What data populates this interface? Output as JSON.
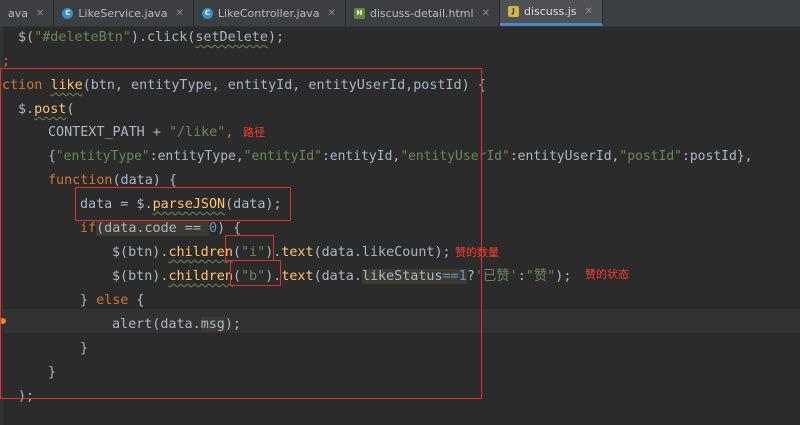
{
  "tabs": [
    {
      "label": "ava",
      "icon": "java"
    },
    {
      "label": "LikeService.java",
      "icon": "java"
    },
    {
      "label": "LikeController.java",
      "icon": "java"
    },
    {
      "label": "discuss-detail.html",
      "icon": "html"
    },
    {
      "label": "discuss.js",
      "icon": "js",
      "active": true
    }
  ],
  "code": {
    "l1": {
      "a": "$(",
      "b": "\"#deleteBtn\"",
      "c": ").click(",
      "d": "setDelete",
      "e": ");"
    },
    "l2": {
      "a": ";"
    },
    "l3": {
      "kw": "nction ",
      "fn": "like",
      "rest": "(btn, entityType, entityId, entityUserId,postId) {"
    },
    "l4": {
      "a": "$.",
      "fn": "post",
      "b": "("
    },
    "l5": {
      "a": "CONTEXT_PATH + ",
      "b": "\"/like\"",
      "c": ","
    },
    "l6": {
      "a": "{",
      "k1": "\"entityType\"",
      "v1": ":entityType,",
      "k2": "\"entityId\"",
      "v2": ":entityId,",
      "k3": "\"entityUserId\"",
      "v3": ":entityUserId,",
      "k4": "\"postId\"",
      "v4": ":postId},"
    },
    "l7": {
      "kw": "function",
      "b": "(data) {"
    },
    "l8": {
      "a": "data = $.",
      "fn": "parseJSON",
      "b": "(data);"
    },
    "l9": {
      "kw": "if",
      "a": "(data.",
      "b": "code",
      "c": " == ",
      "num": "0",
      "d": ") {"
    },
    "l10": {
      "a": "$(btn).",
      "fn": "children",
      "b": "(",
      "s": "\"i\"",
      "c": ").",
      "fn2": "text",
      "d": "(data.likeCount);"
    },
    "l11": {
      "a": "$(btn).",
      "fn": "children",
      "b": "(",
      "s": "\"b\"",
      "c": ").",
      "fn2": "text",
      "d": "(data.",
      "e": "likeStatus",
      "num": "==1",
      "f": "?",
      "s2": "'已赞'",
      "g": ":",
      "s3": "\"赞\"",
      "h": ");"
    },
    "l12": {
      "a": "} ",
      "kw": "else",
      "b": " {"
    },
    "l13": {
      "a": "alert(data.",
      "b": "msg",
      "c": ");"
    },
    "l14": {
      "a": "}"
    },
    "l15": {
      "a": "}"
    },
    "l16": {
      "a": ");"
    }
  },
  "annotations": {
    "path": "路径",
    "like_count": "赞的数量",
    "like_status": "赞的状态"
  },
  "colors": {
    "background": "#2b2b2b",
    "keyword": "#cc7832",
    "function": "#ffc66d",
    "string": "#6a8759",
    "number": "#6897bb",
    "annotation": "#ff3b30"
  }
}
